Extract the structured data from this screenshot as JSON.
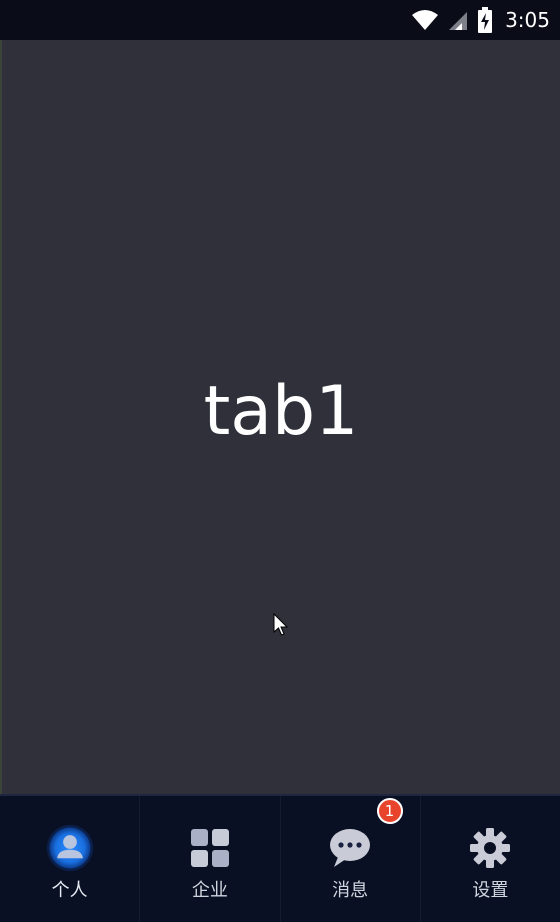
{
  "status_bar": {
    "time": "3:05",
    "icons": [
      "wifi-icon",
      "cell-signal-icon",
      "battery-charging-icon"
    ]
  },
  "content": {
    "label": "tab1"
  },
  "bottom_nav": {
    "active_index": 0,
    "accent_color": "#1a7cf0",
    "badge_color": "#e8442c",
    "items": [
      {
        "label": "个人",
        "icon": "person-icon",
        "badge": ""
      },
      {
        "label": "企业",
        "icon": "grid-icon",
        "badge": ""
      },
      {
        "label": "消息",
        "icon": "chat-bubble-icon",
        "badge": "1"
      },
      {
        "label": "设置",
        "icon": "gear-icon",
        "badge": ""
      }
    ]
  }
}
